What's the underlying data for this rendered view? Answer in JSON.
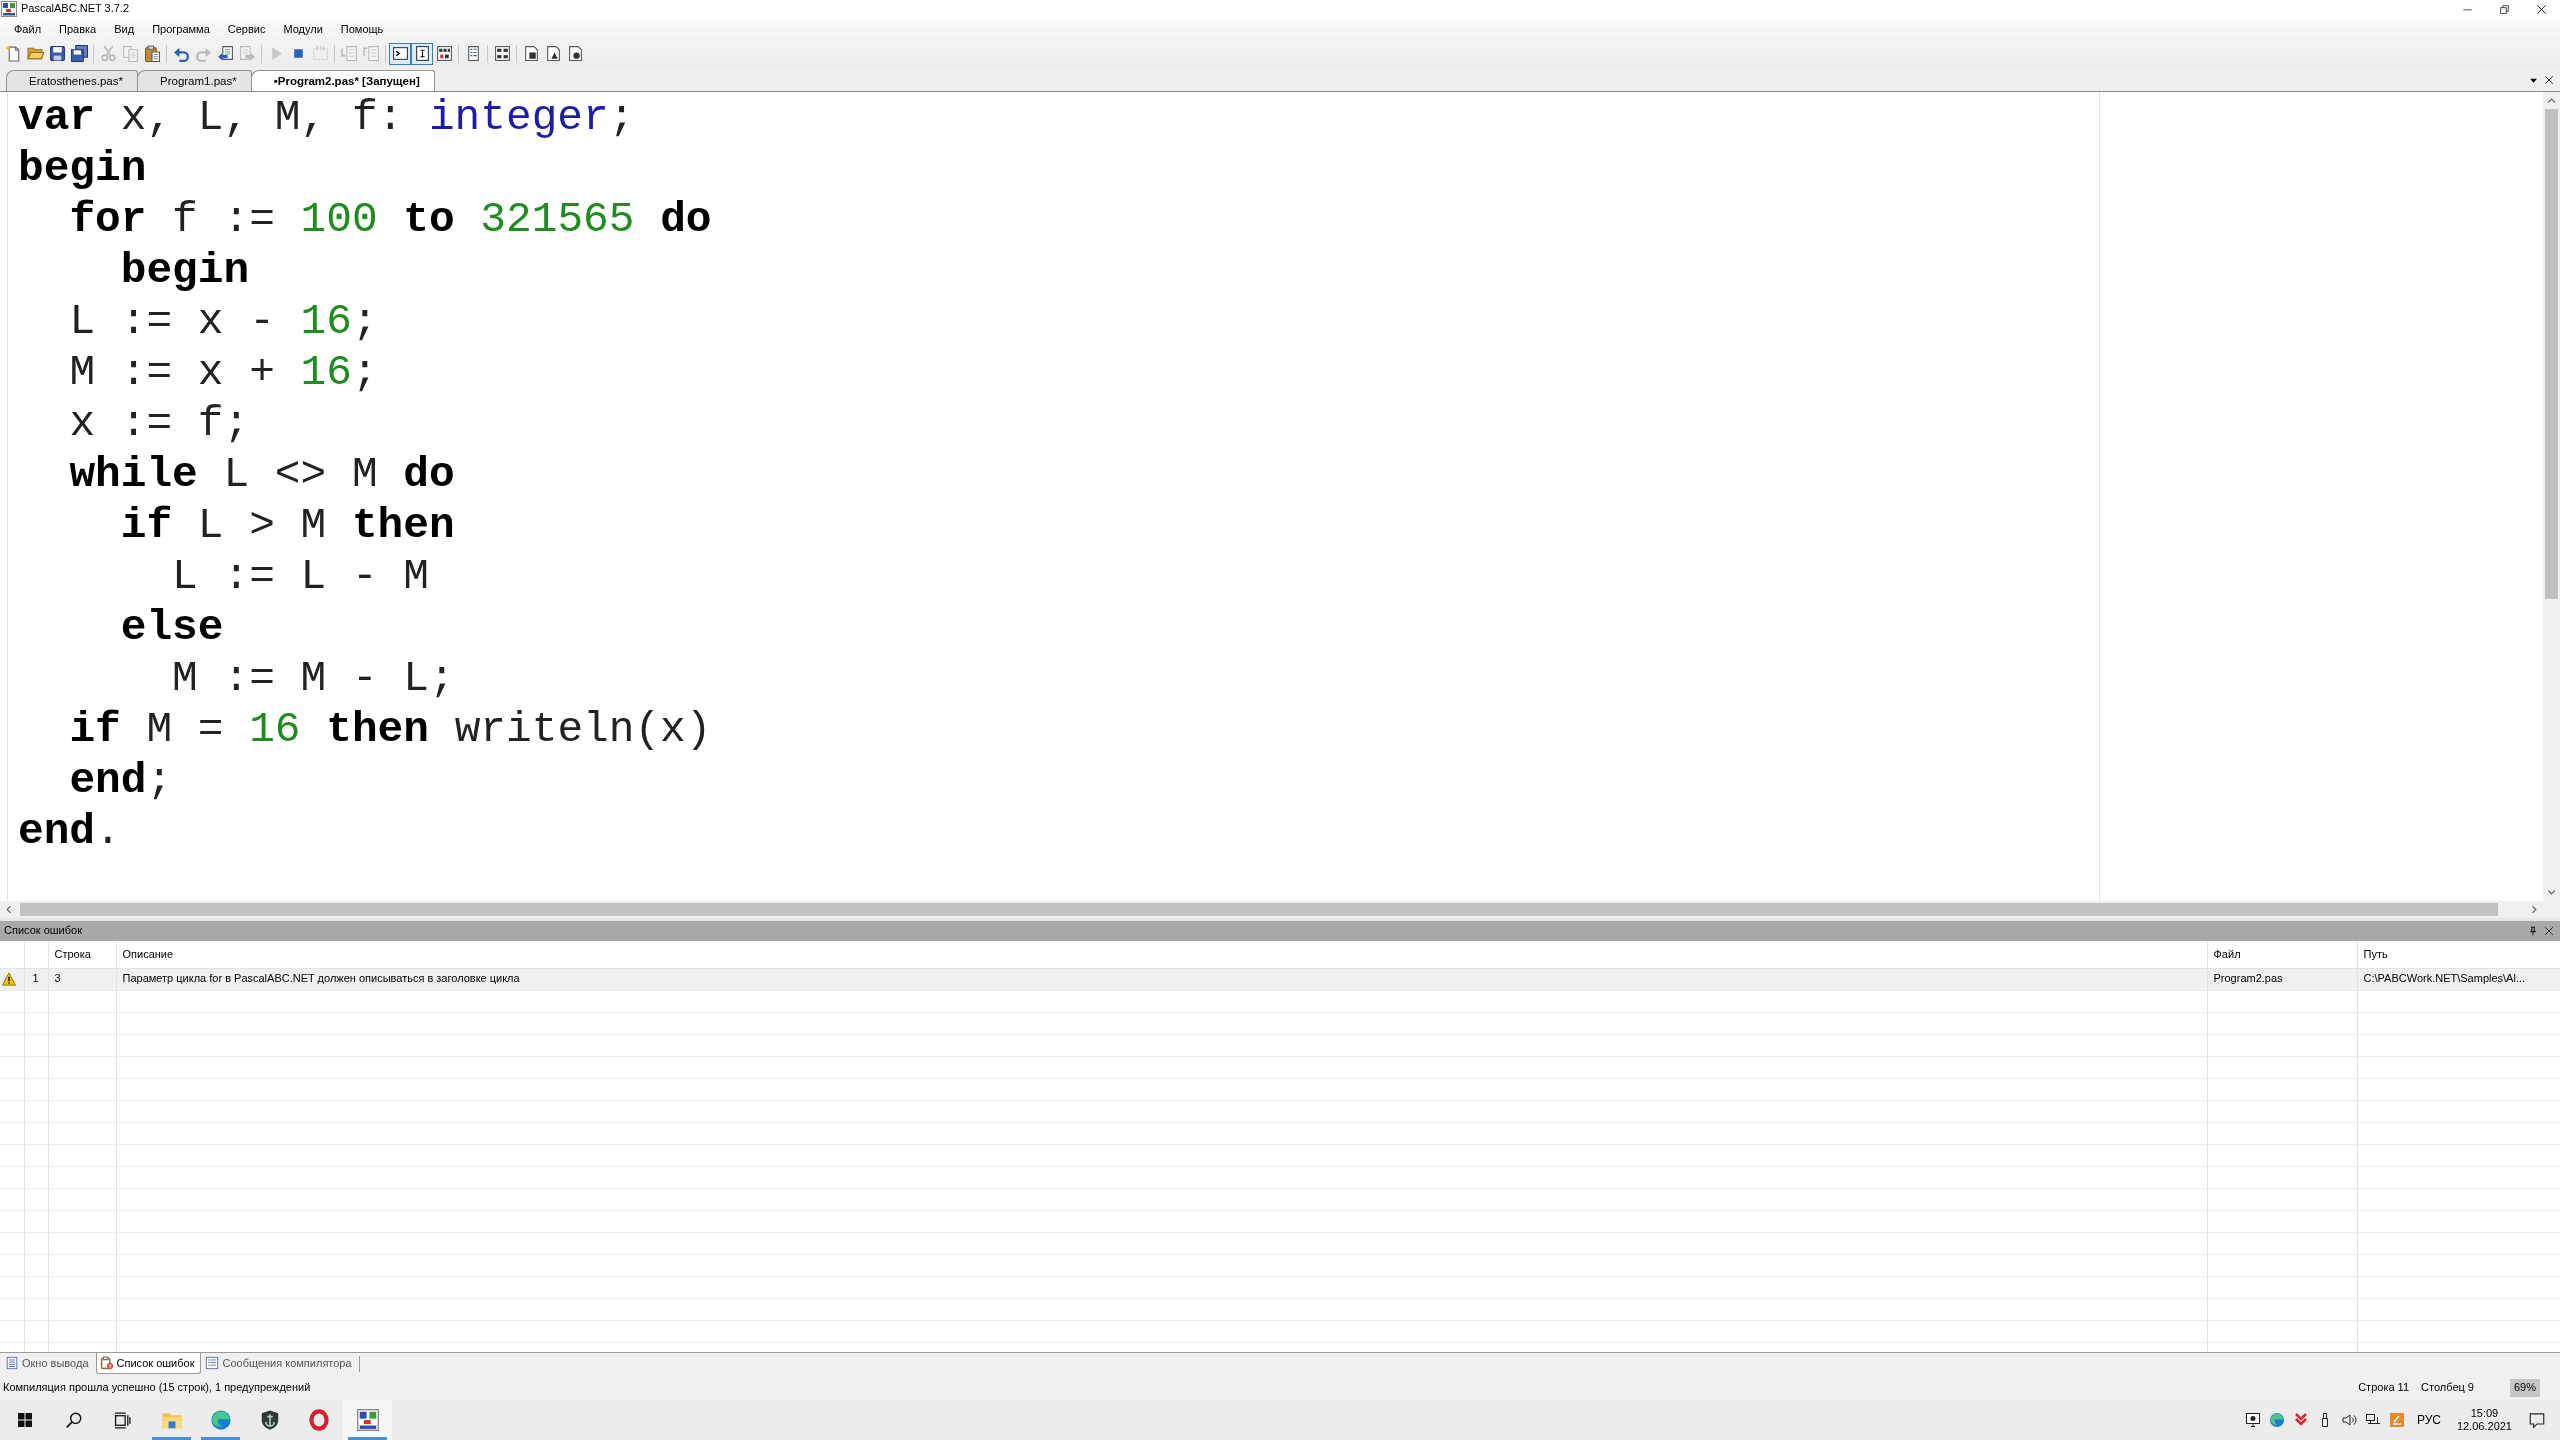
{
  "window": {
    "title": "PascalABC.NET 3.7.2"
  },
  "menu": [
    "Файл",
    "Правка",
    "Вид",
    "Программа",
    "Сервис",
    "Модули",
    "Помощь"
  ],
  "toolbar": [
    {
      "disabled": false,
      "pressed": false
    },
    {
      "disabled": false,
      "pressed": false
    },
    {
      "disabled": false,
      "pressed": false
    },
    {
      "disabled": false,
      "pressed": false
    },
    {
      "disabled": true,
      "pressed": false
    },
    {
      "disabled": true,
      "pressed": false
    },
    {
      "disabled": false,
      "pressed": false
    },
    {
      "disabled": false,
      "pressed": false
    },
    {
      "disabled": true,
      "pressed": false
    },
    {
      "disabled": false,
      "pressed": false
    },
    {
      "disabled": true,
      "pressed": false
    },
    {
      "disabled": true,
      "pressed": false
    },
    {
      "disabled": false,
      "pressed": false
    },
    {
      "disabled": true,
      "pressed": false
    },
    {
      "disabled": true,
      "pressed": false
    },
    {
      "disabled": true,
      "pressed": false
    },
    {
      "disabled": false,
      "pressed": true
    },
    {
      "disabled": false,
      "pressed": true
    },
    {
      "disabled": false,
      "pressed": false
    },
    {
      "disabled": false,
      "pressed": false
    },
    {
      "disabled": false,
      "pressed": false
    },
    {
      "disabled": false,
      "pressed": false
    },
    {
      "disabled": false,
      "pressed": false
    },
    {
      "disabled": false,
      "pressed": false
    }
  ],
  "tabs": [
    {
      "label": "Eratosthenes.pas*",
      "selected": false
    },
    {
      "label": "Program1.pas*",
      "selected": false
    },
    {
      "label": "•Program2.pas* [Запущен]",
      "selected": true
    }
  ],
  "editor": {
    "lines": [
      {
        "tokens": [
          {
            "kind": "keyword",
            "text": "var"
          },
          {
            "kind": "text",
            "text": " x, L, M, f: "
          },
          {
            "kind": "type",
            "text": "integer"
          },
          {
            "kind": "text",
            "text": ";"
          }
        ]
      },
      {
        "tokens": [
          {
            "kind": "keyword",
            "text": "begin"
          }
        ]
      },
      {
        "tokens": [
          {
            "kind": "keyword",
            "text": "  for"
          },
          {
            "kind": "text",
            "text": " f := "
          },
          {
            "kind": "number",
            "text": "100"
          },
          {
            "kind": "keyword",
            "text": " to "
          },
          {
            "kind": "number",
            "text": "321565"
          },
          {
            "kind": "keyword",
            "text": " do"
          }
        ]
      },
      {
        "tokens": [
          {
            "kind": "keyword",
            "text": "    begin"
          }
        ]
      },
      {
        "tokens": [
          {
            "kind": "text",
            "text": "  L := x - "
          },
          {
            "kind": "number",
            "text": "16"
          },
          {
            "kind": "text",
            "text": ";"
          }
        ]
      },
      {
        "tokens": [
          {
            "kind": "text",
            "text": "  M := x + "
          },
          {
            "kind": "number",
            "text": "16"
          },
          {
            "kind": "text",
            "text": ";"
          }
        ]
      },
      {
        "tokens": [
          {
            "kind": "text",
            "text": "  x := f;"
          }
        ]
      },
      {
        "tokens": [
          {
            "kind": "keyword",
            "text": "  while"
          },
          {
            "kind": "text",
            "text": " L <> M "
          },
          {
            "kind": "keyword",
            "text": "do"
          }
        ]
      },
      {
        "tokens": [
          {
            "kind": "keyword",
            "text": "    if"
          },
          {
            "kind": "text",
            "text": " L > M "
          },
          {
            "kind": "keyword",
            "text": "then"
          }
        ]
      },
      {
        "tokens": [
          {
            "kind": "text",
            "text": "      L := L - M"
          }
        ]
      },
      {
        "tokens": [
          {
            "kind": "keyword",
            "text": "    else"
          }
        ]
      },
      {
        "tokens": [
          {
            "kind": "text",
            "text": "      M := M - L;"
          }
        ]
      },
      {
        "tokens": [
          {
            "kind": "keyword",
            "text": "  if"
          },
          {
            "kind": "text",
            "text": " M = "
          },
          {
            "kind": "number",
            "text": "16"
          },
          {
            "kind": "keyword",
            "text": " then"
          },
          {
            "kind": "text",
            "text": " writeln(x)"
          }
        ]
      },
      {
        "tokens": [
          {
            "kind": "keyword",
            "text": "  end"
          },
          {
            "kind": "text",
            "text": ";"
          }
        ]
      },
      {
        "tokens": [
          {
            "kind": "keyword",
            "text": "end"
          },
          {
            "kind": "text",
            "text": "."
          }
        ]
      }
    ]
  },
  "error_list": {
    "title": "Список ошибок",
    "columns": [
      "Строка",
      "Описание",
      "Файл",
      "Путь"
    ],
    "rows": [
      {
        "kind": "warning",
        "selected": true,
        "number": "1",
        "line": "3",
        "description": "Параметр цикла for в PascalABC.NET должен описываться в заголовке цикла",
        "file": "Program2.pas",
        "path": "C:\\PABCWork.NET\\Samples\\Al..."
      }
    ]
  },
  "panel_tabs": [
    {
      "label": "Окно вывода",
      "selected": false
    },
    {
      "label": "Список ошибок",
      "selected": true
    },
    {
      "label": "Сообщения компилятора",
      "selected": false
    }
  ],
  "status_bar": {
    "message": "Компиляция прошла успешно (15 строк), 1 предупреждений",
    "line": "Строка 11",
    "column": "Столбец 9",
    "zoom": "69%"
  },
  "taskbar": {
    "apps": [
      {
        "running": true,
        "active": false
      },
      {
        "running": true,
        "active": false
      },
      {
        "running": false,
        "active": false
      },
      {
        "running": false,
        "active": false
      },
      {
        "running": true,
        "active": true
      }
    ],
    "language": "РУС",
    "time": "15:09",
    "date": "12.06.2021"
  }
}
